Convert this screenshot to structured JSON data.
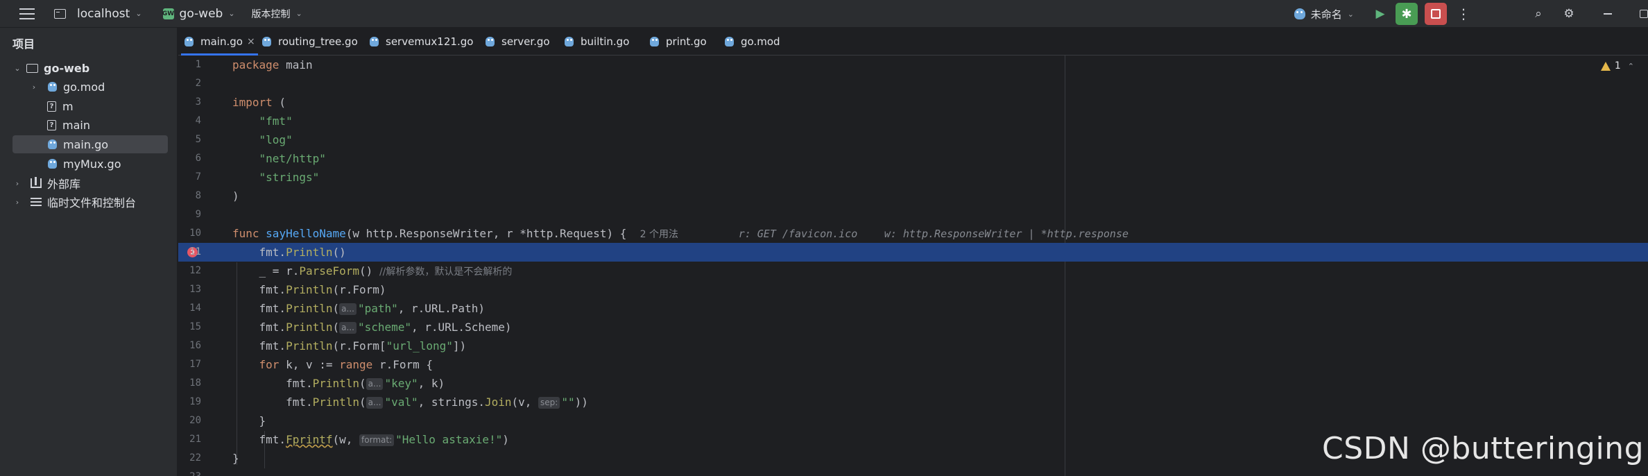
{
  "titlebar": {
    "host": "localhost",
    "project": "go-web",
    "project_badge": "GW",
    "vcs": "版本控制",
    "run_config": "未命名"
  },
  "sidebar": {
    "title": "项目",
    "root": "go-web",
    "items": [
      {
        "label": "go.mod",
        "type": "go",
        "expandable": true
      },
      {
        "label": "m",
        "type": "unknown"
      },
      {
        "label": "main",
        "type": "unknown"
      },
      {
        "label": "main.go",
        "type": "go",
        "selected": true
      },
      {
        "label": "myMux.go",
        "type": "go"
      }
    ],
    "external_libs": "外部库",
    "scratches": "临时文件和控制台"
  },
  "tabs": [
    {
      "label": "main.go",
      "active": true,
      "close": "×"
    },
    {
      "label": "routing_tree.go"
    },
    {
      "label": "servemux121.go"
    },
    {
      "label": "server.go"
    },
    {
      "label": "builtin.go"
    },
    {
      "label": "print.go"
    },
    {
      "label": "go.mod"
    }
  ],
  "editor": {
    "warnings": "1",
    "line_numbers": [
      "1",
      "2",
      "3",
      "4",
      "5",
      "6",
      "7",
      "8",
      "9",
      "10",
      "11",
      "12",
      "13",
      "14",
      "15",
      "16",
      "17",
      "18",
      "19",
      "20",
      "21",
      "22",
      "23"
    ],
    "current_line": 11,
    "breakpoint_line": 11,
    "usages": "2 个用法",
    "hint_r": "r: GET /favicon.ico",
    "hint_w": "w: http.ResponseWriter | *http.response",
    "comment_parse": "//解析参数，默认是不会解析的",
    "inlay_a": "a...",
    "inlay_sep": "sep:",
    "inlay_format": "format:"
  },
  "watermark": "CSDN @butteringing",
  "colors": {
    "accent": "#3574f0",
    "current_line": "#214283",
    "keyword": "#cf8e6d",
    "string": "#6aab73",
    "function": "#56a8f5",
    "breakpoint": "#e55765",
    "run": "#499c54",
    "stop": "#c94f4f"
  },
  "icons": {
    "menu": "hamburger-icon",
    "run": "run-icon",
    "debug": "debug-icon",
    "stop": "stop-icon",
    "search": "search-icon",
    "settings": "gear-icon"
  }
}
